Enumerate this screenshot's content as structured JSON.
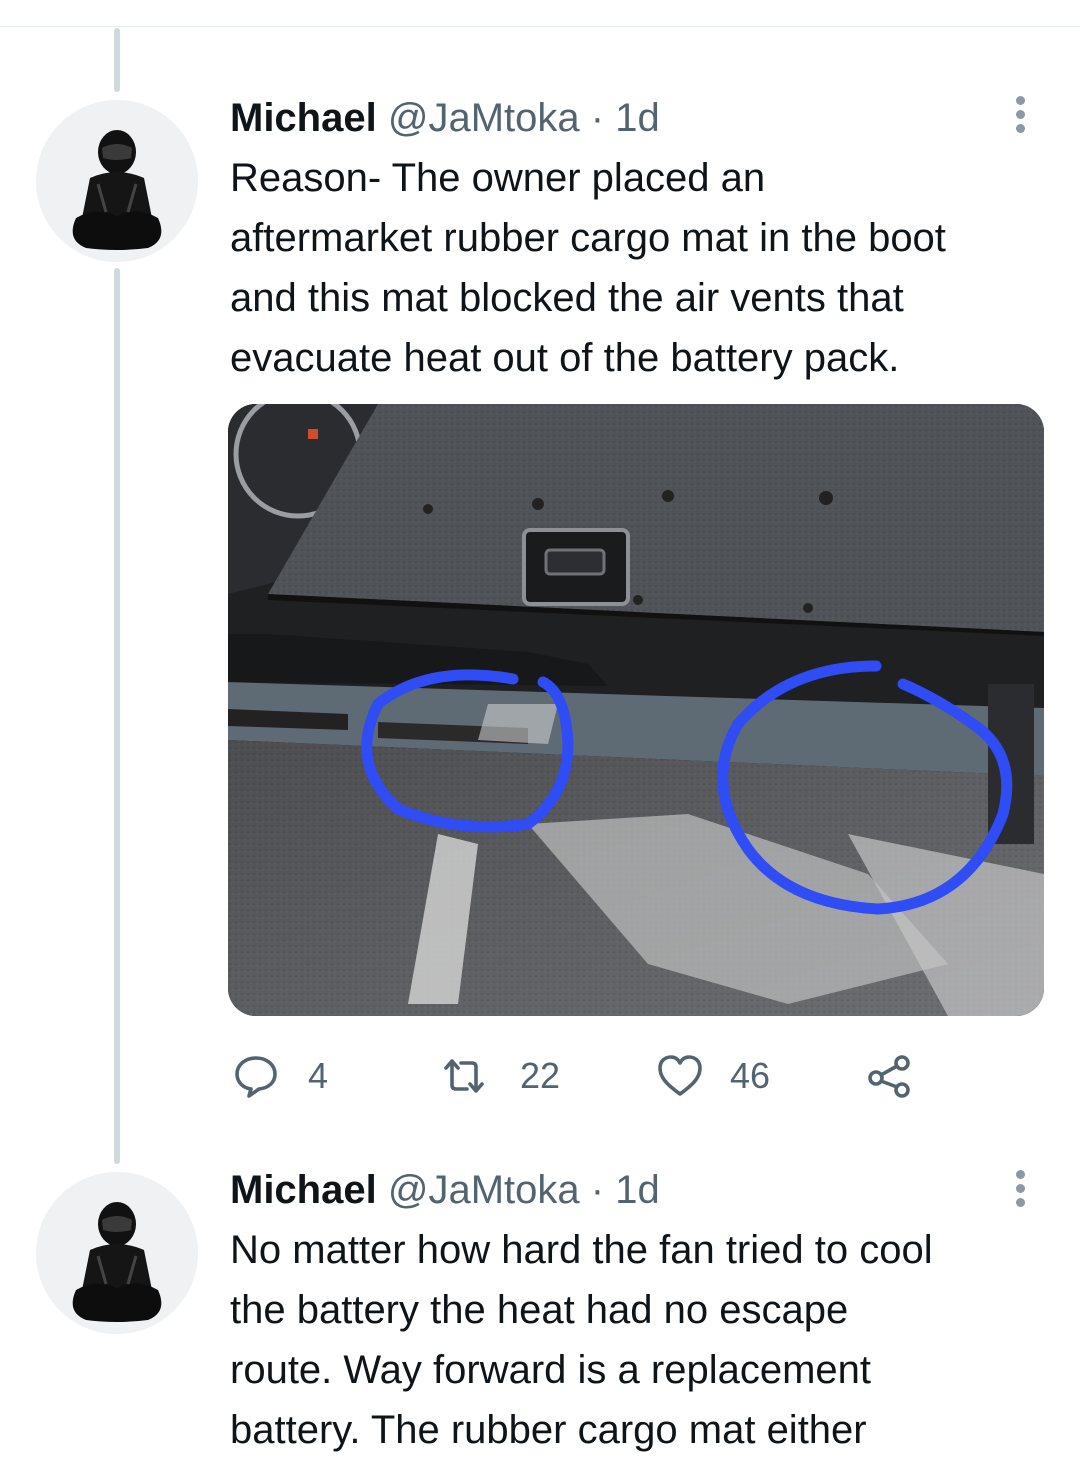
{
  "tweets": [
    {
      "name": "Michael",
      "handle": "@JaMtoka",
      "separator": "·",
      "time": "1d",
      "text": "Reason- The owner placed an\naftermarket rubber cargo mat in the boot\nand this mat blocked the air vents that\nevacuate heat out of the battery pack.",
      "actions": {
        "replies": "4",
        "retweets": "22",
        "likes": "46"
      }
    },
    {
      "name": "Michael",
      "handle": "@JaMtoka",
      "separator": "·",
      "time": "1d",
      "text": "No matter how hard the fan tried to cool\nthe battery the heat had no escape\nroute. Way forward is a replacement\nbattery. The rubber cargo mat either"
    }
  ],
  "icons": {
    "reply": "reply-icon",
    "retweet": "retweet-icon",
    "like": "heart-icon",
    "share": "share-icon",
    "more": "more-vertical-icon"
  },
  "colors": {
    "text_primary": "#0f1419",
    "text_secondary": "#536471",
    "thread_line": "#cfd9de",
    "annotation_circle": "#2f4cf5"
  }
}
